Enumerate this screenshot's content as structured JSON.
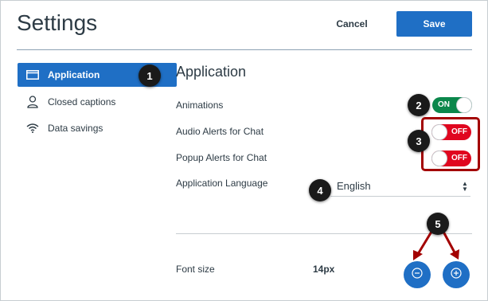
{
  "header": {
    "title": "Settings",
    "cancel_label": "Cancel",
    "save_label": "Save"
  },
  "sidebar": {
    "items": [
      {
        "label": "Application",
        "icon": "window-icon",
        "active": true
      },
      {
        "label": "Closed captions",
        "icon": "person-icon",
        "active": false
      },
      {
        "label": "Data savings",
        "icon": "wifi-icon",
        "active": false
      }
    ]
  },
  "main": {
    "section_title": "Application",
    "animations": {
      "label": "Animations",
      "state": "ON"
    },
    "audio_alerts": {
      "label": "Audio Alerts for Chat",
      "state": "OFF"
    },
    "popup_alerts": {
      "label": "Popup Alerts for Chat",
      "state": "OFF"
    },
    "language": {
      "label": "Application Language",
      "selected": "English"
    },
    "font_size": {
      "label": "Font size",
      "value": "14px"
    }
  },
  "callouts": [
    "1",
    "2",
    "3",
    "4",
    "5"
  ],
  "colors": {
    "accent": "#1f6fc5",
    "on": "#0b874b",
    "off": "#e0061f",
    "annotation": "#a30000"
  }
}
